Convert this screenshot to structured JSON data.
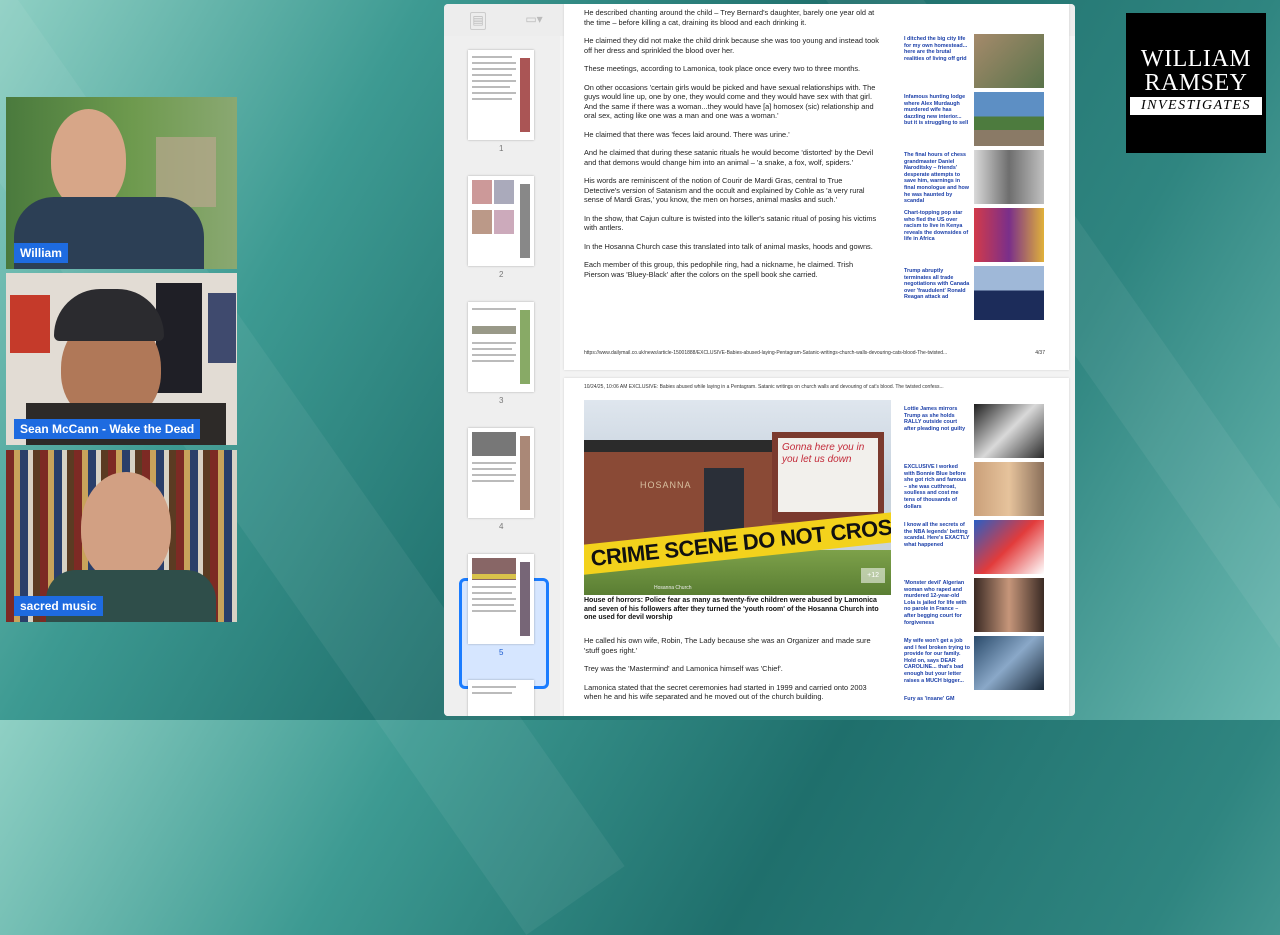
{
  "participants": [
    {
      "name": "William"
    },
    {
      "name": "Sean McCann - Wake the Dead"
    },
    {
      "name": "sacred music"
    }
  ],
  "logo": {
    "line1": "WILLIAM",
    "line2": "RAMSEY",
    "line3": "INVESTIGATES"
  },
  "viewer": {
    "thumbnails": [
      "1",
      "2",
      "3",
      "4",
      "5"
    ],
    "selected_page": "5"
  },
  "page4": {
    "paragraphs": [
      "He described chanting around the child – Trey Bernard's daughter, barely one year old at the time – before killing a cat, draining its blood and each drinking it.",
      "He claimed they did not make the child drink because she was too young and instead took off her dress and sprinkled the blood over her.",
      "These meetings, according to Lamonica, took place once every two to three months.",
      "On other occasions 'certain girls would be picked and have sexual relationships with. The guys would line up, one by one, they would come and they would have sex with that girl. And the same if there was a woman...they would have [a] homosex (sic) relationship and oral sex, acting like one was a man and one was a woman.'",
      "He claimed that there was 'feces laid around. There was urine.'",
      "And he claimed that during these satanic rituals he would become 'distorted' by the Devil and that demons would change him into an animal – 'a snake, a fox, wolf, spiders.'",
      "His words are reminiscent of the notion of Courir de Mardi Gras, central to True Detective's version of Satanism and the occult and explained by Cohle as 'a very rural sense of Mardi Gras,' you know, the men on horses, animal masks and such.'",
      "In the show, that Cajun culture is twisted into the killer's satanic ritual of posing his victims with antlers.",
      "In the Hosanna Church case this translated into talk of animal masks, hoods and gowns.",
      "Each member of this group, this pedophile ring, had a nickname, he claimed. Trish Pierson was 'Bluey-Black' after the colors on the spell book she carried."
    ],
    "sidebar": [
      "I ditched the big city life for my own homestead... here are the brutal realities of living off grid",
      "Infamous hunting lodge where Alex Murdaugh murdered wife has dazzling new interior... but it is struggling to sell",
      "The final hours of chess grandmaster Daniel Naroditsky – friends' desperate attempts to save him, warnings in final monologue and how he was haunted by scandal",
      "Chart-topping pop star who fled the US over racism to live in Kenya reveals the downsides of life in Africa",
      "Trump abruptly terminates all trade negotiations with Canada over 'fraudulent' Ronald Reagan attack ad"
    ],
    "url": "https://www.dailymail.co.uk/news/article-15001888/EXCLUSIVE-Babies-abused-laying-Pentagram-Satanic-writings-church-walls-devouring-cats-blood-The-twisted...",
    "page_number": "4/37"
  },
  "page5": {
    "header": "10/24/25, 10:06 AM        EXCLUSIVE: Babies abused while laying in a Pentagram. Satanic writings on church walls and devouring of cat's blood. The twisted confess...",
    "photo_sign_text": "Hosanna",
    "photo_sign_graffiti": "Gonna here you in you let us down",
    "tape_text": "CRIME SCENE DO NOT CROSS",
    "photo_badge": "+12",
    "photo_credit": "Hosanna Church",
    "caption": "House of horrors: Police fear as many as twenty-five children were abused by Lamonica and seven of his followers after they turned the 'youth room' of the Hosanna Church into one used for devil worship",
    "paragraphs": [
      "He called his own wife, Robin, The Lady because she was an Organizer and made sure 'stuff goes right.'",
      "Trey was the 'Mastermind' and Lamonica himself was 'Chief'.",
      "Lamonica stated that the secret ceremonies had started in 1999 and carried onto 2003 when he and his wife separated and he moved out of the church building."
    ],
    "sidebar": [
      "Lottie James mirrors Trump as she holds RALLY outside court after pleading not guilty",
      "EXCLUSIVE I worked with Bonnie Blue before she got rich and famous – she was cutthroat, soulless and cost me tens of thousands of dollars",
      "I know all the secrets of the NBA legends' betting scandal. Here's EXACTLY what happened",
      "'Monster devil' Algerian woman who raped and murdered 12-year-old Lola is jailed for life with no parole in France – after begging court for forgiveness",
      "My wife won't get a job and I feel broken trying to provide for our family. Hold on, says DEAR CAROLINE... that's bad enough but your letter raises a MUCH bigger...",
      "Fury as 'insane' GM"
    ]
  }
}
